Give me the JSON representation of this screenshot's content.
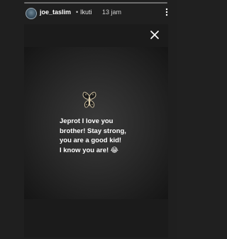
{
  "story": {
    "progress": 0.0
  },
  "header": {
    "username": "joe_taslim",
    "separator": "•",
    "follow_label": "Ikuti",
    "timestamp": "13 jam"
  },
  "icons": {
    "more": "more-vertical-icon",
    "close": "close-icon",
    "butterfly": "butterfly-icon"
  },
  "message": {
    "lines": [
      "Jeprot I love you",
      "brother! Stay strong,",
      "you are a good kid!",
      "I know you are! 😂"
    ]
  },
  "colors": {
    "background": "#1f1f1f",
    "text": "#ffffff"
  }
}
